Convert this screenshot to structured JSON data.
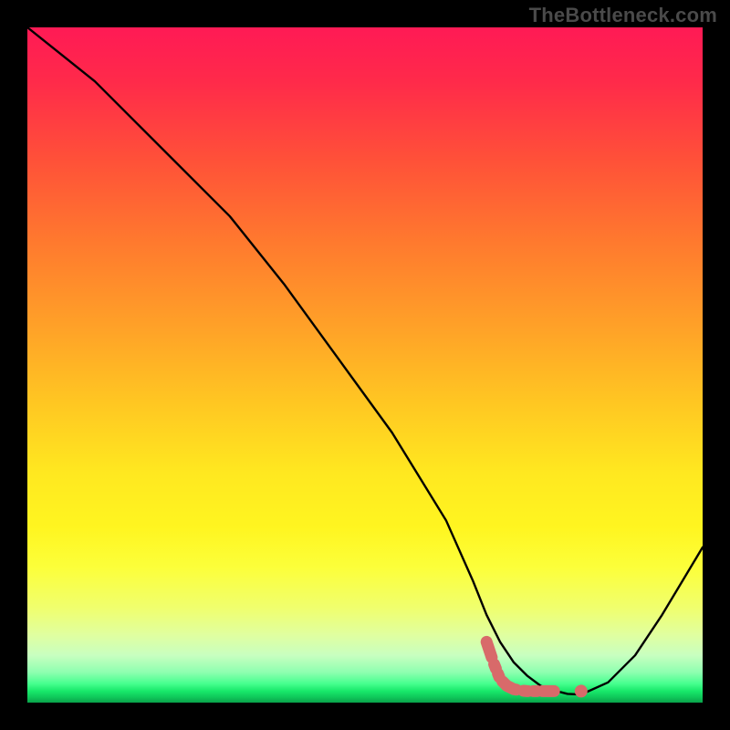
{
  "watermark": "TheBottleneck.com",
  "chart_data": {
    "type": "line",
    "title": "",
    "xlabel": "",
    "ylabel": "",
    "xlim": [
      0,
      100
    ],
    "ylim": [
      0,
      100
    ],
    "series": [
      {
        "name": "curve",
        "x": [
          0,
          10,
          22,
          30,
          38,
          46,
          54,
          62,
          66,
          68,
          70,
          72,
          74,
          76,
          78,
          80,
          82,
          86,
          90,
          94,
          100
        ],
        "values": [
          100,
          92,
          80,
          72,
          62,
          51,
          40,
          27,
          18,
          13,
          9,
          6,
          4,
          2.5,
          1.8,
          1.3,
          1.2,
          3.0,
          7.0,
          13,
          23
        ]
      },
      {
        "name": "marker-segment",
        "style": "thick",
        "color": "#d86a6a",
        "x": [
          68,
          69,
          70,
          71,
          72,
          73,
          74,
          77,
          78,
          82
        ],
        "values": [
          9.0,
          6.0,
          3.5,
          2.5,
          2.0,
          1.8,
          1.7,
          1.7,
          1.7,
          1.7
        ]
      }
    ],
    "gradient_stops": [
      {
        "pos": 0,
        "color": "#ff1a55"
      },
      {
        "pos": 50,
        "color": "#ffc822"
      },
      {
        "pos": 85,
        "color": "#f0ff6e"
      },
      {
        "pos": 100,
        "color": "#0aa24a"
      }
    ]
  }
}
